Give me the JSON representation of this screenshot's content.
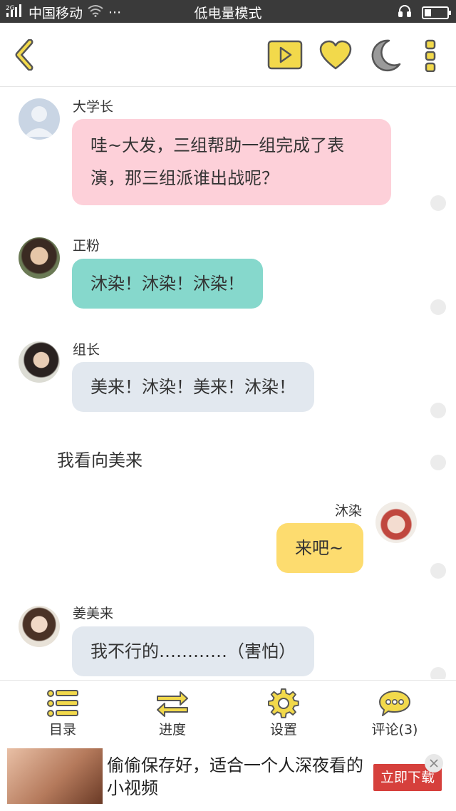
{
  "status": {
    "network": "2G",
    "carrier": "中国移动",
    "more": "···",
    "mode": "低电量模式",
    "battery_level": 0.3
  },
  "topbar": {
    "back_icon": "chevron-left-icon",
    "play_icon": "play-icon",
    "favorite_icon": "heart-icon",
    "night_icon": "moon-icon",
    "more_icon": "more-vertical-icon",
    "accent": "#f2d94b"
  },
  "messages": [
    {
      "type": "left",
      "name": "大学长",
      "text_l1": "哇~大发，三组帮助一组完成了表",
      "text_l2": "演，那三组派谁出战呢？",
      "color": "#fdd0d9"
    },
    {
      "type": "left",
      "name": "正粉",
      "text": "沐染！沐染！沐染！",
      "color": "#86d8cc"
    },
    {
      "type": "left",
      "name": "组长",
      "text": "美来！沐染！美来！沐染！",
      "color": "#e2e8ef"
    },
    {
      "type": "narration",
      "text": "我看向美来"
    },
    {
      "type": "right",
      "name": "沐染",
      "text": "来吧~",
      "color": "#fddc6f"
    },
    {
      "type": "left",
      "name": "姜美来",
      "text": "我不行的…………（害怕）",
      "color": "#e2e8ef"
    }
  ],
  "nav": {
    "toc": "目录",
    "progress": "进度",
    "settings": "设置",
    "comments": "评论(3)"
  },
  "ad": {
    "text": "偷偷保存好，适合一个人深夜看的小视频",
    "cta": "立即下载"
  }
}
